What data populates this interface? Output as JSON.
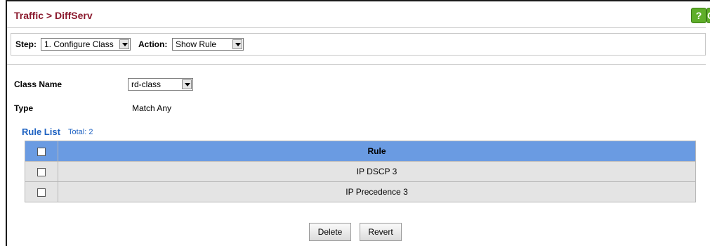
{
  "header": {
    "title": "Traffic > DiffServ",
    "help_label": "?",
    "next_label": "G"
  },
  "stepbar": {
    "step_label": "Step:",
    "step_value": "1. Configure Class",
    "action_label": "Action:",
    "action_value": "Show Rule"
  },
  "form": {
    "class_name_label": "Class Name",
    "class_name_value": "rd-class",
    "type_label": "Type",
    "type_value": "Match Any"
  },
  "rule_list": {
    "title": "Rule List",
    "total": "Total: 2",
    "column_header": "Rule",
    "rows": [
      "IP DSCP 3",
      "IP Precedence 3"
    ]
  },
  "buttons": {
    "delete_label": "Delete",
    "revert_label": "Revert"
  },
  "colors": {
    "title": "#8b1a2e",
    "header_row": "#6a9be2",
    "row_bg": "#e4e4e4",
    "link_blue": "#1e62c2",
    "help_green": "#5fae2a"
  }
}
